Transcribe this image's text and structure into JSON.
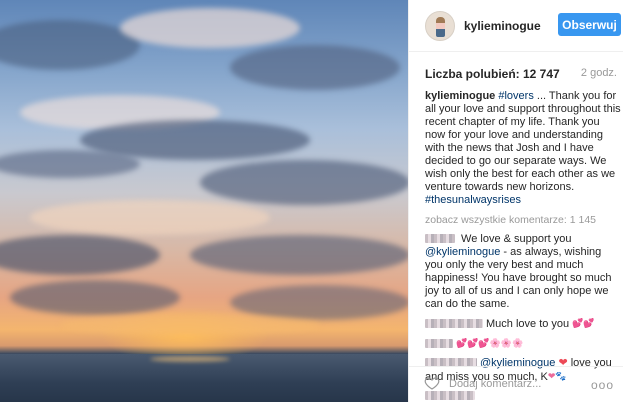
{
  "post": {
    "image_alt": "sunset over sea with clouds"
  },
  "header": {
    "username": "kylieminogue",
    "follow_label": "Obserwuj"
  },
  "stats": {
    "likes_text": "Liczba polubień: 12 747",
    "time_ago": "2 godz."
  },
  "caption": {
    "user": "kylieminogue",
    "tag_start": "#lovers",
    "text": " ... Thank you for all your love and support throughout this recent chapter of my life. Thank you now for your love and understanding with the news that Josh and I have decided to go our separate ways. We wish only the best for each other as we venture towards new horizons.",
    "tag_end": "#thesunalwaysrises"
  },
  "view_all": "zobacz wszystkie komentarze: 1 145",
  "comments": [
    {
      "pre": " We love & support you ",
      "mention": "@kylieminogue",
      "post": " - as always, wishing you only the very best and much happiness! You have brought so much joy to all of us and I can only hope we can do the same."
    },
    {
      "pre": "Much love to you ",
      "emoji": "💕💕"
    },
    {
      "emoji": "💕💕💕🌸🌸🌸"
    },
    {
      "mention": "@kylieminogue",
      "heart": "❤",
      "post": " love you and miss you so much, K",
      "emoji": "❤🐾"
    }
  ],
  "footer": {
    "add_comment_placeholder": "Dodaj komentarz...",
    "more_label": "ooo"
  },
  "colors": {
    "follow_button": "#3897f0",
    "link": "#003569",
    "heart": "#ed4956"
  },
  "icons": {
    "like": "heart-outline-icon",
    "more": "more-options-icon"
  }
}
